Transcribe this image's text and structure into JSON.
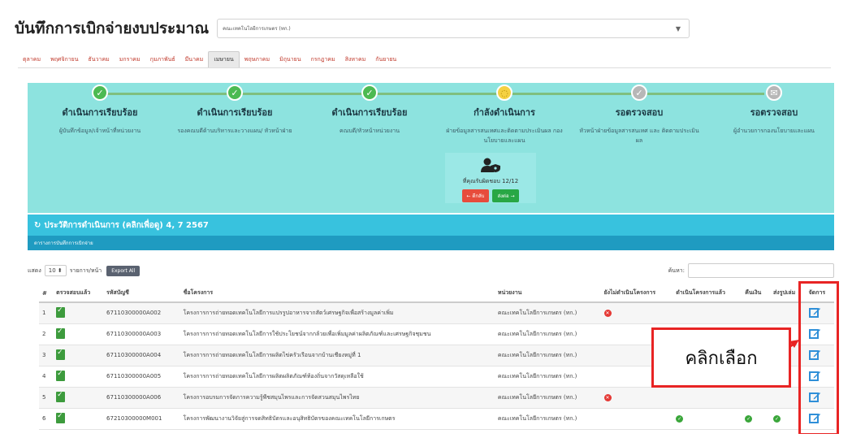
{
  "header": {
    "title": "บันทึกการเบิกจ่ายงบประมาณ",
    "dept_select_value": "คณะเทคโนโลยีการเกษตร (ทก.)"
  },
  "months": [
    {
      "label": "ตุลาคม",
      "active": false
    },
    {
      "label": "พฤศจิกายน",
      "active": false
    },
    {
      "label": "ธันวาคม",
      "active": false
    },
    {
      "label": "มกราคม",
      "active": false
    },
    {
      "label": "กุมภาพันธ์",
      "active": false
    },
    {
      "label": "มีนาคม",
      "active": false
    },
    {
      "label": "เมษายน",
      "active": true
    },
    {
      "label": "พฤษภาคม",
      "active": false
    },
    {
      "label": "มิถุนายน",
      "active": false
    },
    {
      "label": "กรกฎาคม",
      "active": false
    },
    {
      "label": "สิงหาคม",
      "active": false
    },
    {
      "label": "กันยายน",
      "active": false
    }
  ],
  "workflow": {
    "steps": [
      {
        "state": "done",
        "status": "ดำเนินการเรียบร้อย",
        "desc": "ผู้บันทึกข้อมูล/เจ้าหน้าที่หน่วยงาน"
      },
      {
        "state": "done",
        "status": "ดำเนินการเรียบร้อย",
        "desc": "รองคณบดีด้านบริหารและวางแผน/ หัวหน้าฝ่าย"
      },
      {
        "state": "done",
        "status": "ดำเนินการเรียบร้อย",
        "desc": "คณบดี/หัวหน้าหน่วยงาน"
      },
      {
        "state": "current",
        "status": "กำลังดำเนินการ",
        "desc": "ฝ่ายข้อมูลสารสนเทศและติดตามประเมินผล กองนโยบายและแผน"
      },
      {
        "state": "wait",
        "status": "รอตรวจสอบ",
        "desc": "หัวหน้าฝ่ายข้อมูลสารสนเทศ และ ติดตามประเมินผล"
      },
      {
        "state": "wait",
        "status": "รอตรวจสอบ",
        "desc": "ผู้อำนวยการกองนโยบายและแผน"
      }
    ],
    "current_box": {
      "claim_text": "ที่คุณรับผิดชอบ 12/12",
      "back_label": "← ตีกลับ",
      "send_label": "ส่งต่อ →"
    }
  },
  "history": {
    "label": "ประวัติการดำเนินการ (คลิกเพื่อดู) 4, 7 2567",
    "sub_label": "ตารางการบันทึกการเบิกจ่าย"
  },
  "table_controls": {
    "show_label": "แสดง",
    "page_size": "10",
    "entries_label": "รายการ/หน้า",
    "export_label": "Export All",
    "search_label": "ค้นหา:"
  },
  "table": {
    "headers": [
      "#",
      "ตรวจสอบแล้ว",
      "รหัสบัญชี",
      "ชื่อโครงการ",
      "หน่วยงาน",
      "ยังไม่ดำเนินโครงการ",
      "ดำเนินโครงการแล้ว",
      "คืนเงิน",
      "ส่งรูปเล่ม",
      "จัดการ"
    ],
    "rows": [
      {
        "n": "1",
        "code": "67110300000A002",
        "name": "โครงการการถ่ายทอดเทคโนโลยีการแปรรูปอาหารจากสัตว์เศรษฐกิจเพื่อสร้างมูลค่าเพิ่ม",
        "unit": "คณะเทคโนโลยีการเกษตร (ทก.)",
        "not_started": "x",
        "done": "",
        "refund": "",
        "report": ""
      },
      {
        "n": "2",
        "code": "67110300000A003",
        "name": "โครงการการถ่ายทอดเทคโนโลยีการใช้ประโยชน์จากกล้วยเพื่อเพิ่มมูลค่าผลิตภัณฑ์และเศรษฐกิจชุมชน",
        "unit": "คณะเทคโนโลยีการเกษตร (ทก.)",
        "not_started": "",
        "done": "",
        "refund": "",
        "report": ""
      },
      {
        "n": "3",
        "code": "67110300000A004",
        "name": "โครงการการถ่ายทอดเทคโนโลยีการผลิตไข่ครัวเรือนจากบ้านเชียงหมู่ที่ 1",
        "unit": "คณะเทคโนโลยีการเกษตร (ทก.)",
        "not_started": "",
        "done": "",
        "refund": "",
        "report": ""
      },
      {
        "n": "4",
        "code": "67110300000A005",
        "name": "โครงการการถ่ายทอดเทคโนโลยีการผลิตผลิตภัณฑ์ท้องถิ่นจากวัสดุเหลือใช้",
        "unit": "คณะเทคโนโลยีการเกษตร (ทก.)",
        "not_started": "",
        "done": "",
        "refund": "",
        "report": ""
      },
      {
        "n": "5",
        "code": "67110300000A006",
        "name": "โครงการอบรมการจัดการความรู้พืชสมุนไพรและการจัดสวนสมุนไพรไทย",
        "unit": "คณะเทคโนโลยีการเกษตร (ทก.)",
        "not_started": "x",
        "done": "",
        "refund": "",
        "report": ""
      },
      {
        "n": "6",
        "code": "67210300000M001",
        "name": "โครงการพัฒนางานวิจัยสู่การจดสิทธิบัตรและอนุสิทธิบัตรของคณะเทคโนโลยีการเกษตร",
        "unit": "คณะเทคโนโลยีการเกษตร (ทก.)",
        "not_started": "",
        "done": "ok",
        "refund": "ok",
        "report": "ok"
      }
    ]
  },
  "annotation": {
    "callout_text": "คลิกเลือก",
    "color": "#e82424"
  },
  "colors": {
    "workflow_bg": "#8de3df",
    "history_bg": "#38c2de",
    "subbar_bg": "#1f9bc1",
    "done": "#4cba52",
    "current": "#f5d142",
    "wait": "#b7b7b7",
    "month_link": "#c0392b"
  }
}
